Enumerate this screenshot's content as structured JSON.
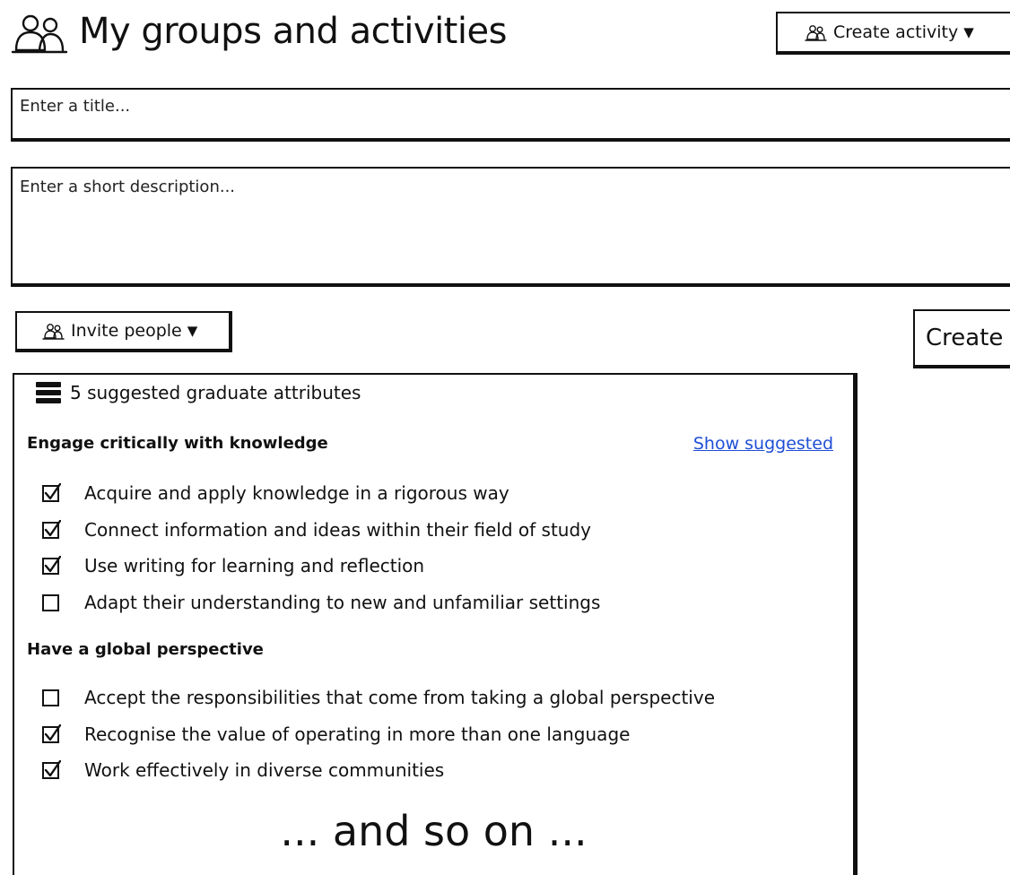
{
  "header": {
    "title": "My groups and activities",
    "icon": "people-icon",
    "create_activity_label": "Create activity"
  },
  "form": {
    "title_placeholder": "Enter a title...",
    "description_placeholder": "Enter a short description..."
  },
  "actions": {
    "invite_label": "Invite people",
    "create_label": "Create"
  },
  "attributes": {
    "header_label": "5 suggested graduate attributes",
    "show_suggested_label": "Show suggested",
    "groups": [
      {
        "heading": "Engage critically with knowledge",
        "items": [
          {
            "label": "Acquire and apply knowledge in a rigorous way",
            "checked": true
          },
          {
            "label": "Connect information and ideas within their field of study",
            "checked": true
          },
          {
            "label": "Use writing for learning and reflection",
            "checked": true
          },
          {
            "label": "Adapt their understanding to new and unfamiliar settings",
            "checked": false
          }
        ]
      },
      {
        "heading": "Have a global perspective",
        "items": [
          {
            "label": "Accept the responsibilities that come from taking a global perspective",
            "checked": false
          },
          {
            "label": "Recognise the value of operating in more than one language",
            "checked": true
          },
          {
            "label": "Work effectively in diverse communities",
            "checked": true
          }
        ]
      }
    ],
    "more_text": "... and so on ..."
  },
  "colors": {
    "ink": "#111111",
    "link": "#1f4fd6",
    "background": "#ffffff"
  }
}
